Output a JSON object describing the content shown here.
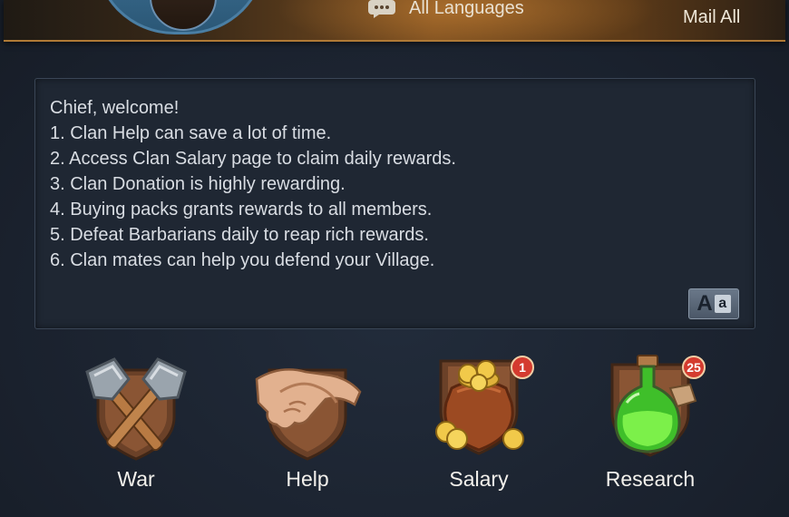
{
  "header": {
    "language_label": "All Languages",
    "mail_all_label": "Mail All"
  },
  "message": {
    "lines": [
      "Chief, welcome!",
      "1. Clan Help can save a lot of time.",
      "2. Access Clan Salary page to claim daily rewards.",
      "3. Clan Donation is highly rewarding.",
      "4. Buying packs grants rewards to all members.",
      "5. Defeat Barbarians daily to reap rich rewards.",
      "6. Clan mates can help you defend your Village."
    ],
    "translate_big": "A",
    "translate_small": "a"
  },
  "features": {
    "war": {
      "label": "War",
      "icon": "crossed-axes-icon"
    },
    "help": {
      "label": "Help",
      "icon": "handshake-icon"
    },
    "salary": {
      "label": "Salary",
      "icon": "gold-sack-icon",
      "badge": "1"
    },
    "research": {
      "label": "Research",
      "icon": "potion-flask-icon",
      "badge": "25"
    }
  },
  "colors": {
    "background": "#1c2431",
    "banner_accent": "#b07a36",
    "badge": "#d43b2f",
    "text": "#d9dde3"
  }
}
